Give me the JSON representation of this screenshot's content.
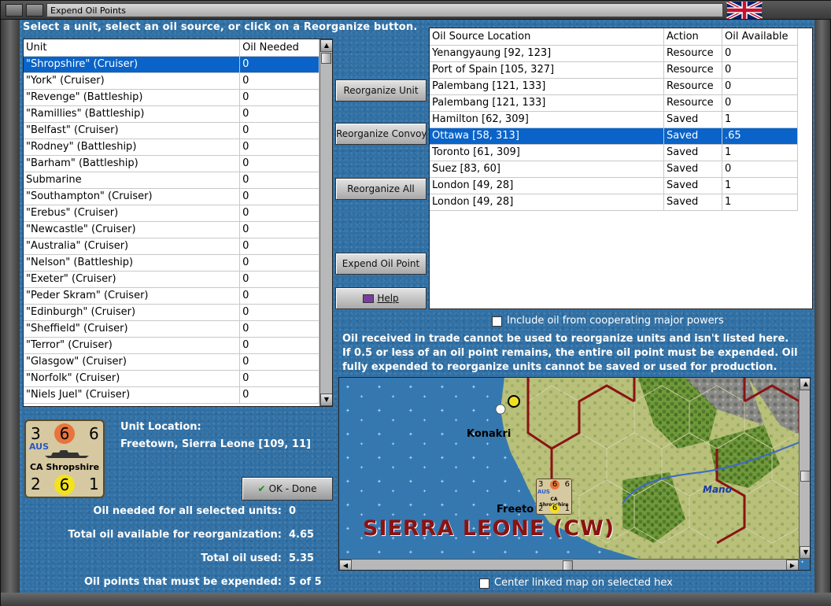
{
  "window": {
    "title": "Expend Oil Points"
  },
  "instruction": "Select a unit, select an oil source, or click on a Reorganize button.",
  "units_table": {
    "headers": [
      "Unit",
      "Oil Needed"
    ],
    "rows": [
      {
        "unit": "\"Shropshire\" (Cruiser)",
        "oil": "0",
        "selected": true
      },
      {
        "unit": "\"York\" (Cruiser)",
        "oil": "0"
      },
      {
        "unit": "\"Revenge\" (Battleship)",
        "oil": "0"
      },
      {
        "unit": "\"Ramillies\" (Battleship)",
        "oil": "0"
      },
      {
        "unit": "\"Belfast\" (Cruiser)",
        "oil": "0"
      },
      {
        "unit": "\"Rodney\" (Battleship)",
        "oil": "0"
      },
      {
        "unit": "\"Barham\" (Battleship)",
        "oil": "0"
      },
      {
        "unit": "Submarine",
        "oil": "0"
      },
      {
        "unit": "\"Southampton\" (Cruiser)",
        "oil": "0"
      },
      {
        "unit": "\"Erebus\" (Cruiser)",
        "oil": "0"
      },
      {
        "unit": "\"Newcastle\" (Cruiser)",
        "oil": "0"
      },
      {
        "unit": "\"Australia\" (Cruiser)",
        "oil": "0"
      },
      {
        "unit": "\"Nelson\" (Battleship)",
        "oil": "0"
      },
      {
        "unit": "\"Exeter\" (Cruiser)",
        "oil": "0"
      },
      {
        "unit": "\"Peder Skram\" (Cruiser)",
        "oil": "0"
      },
      {
        "unit": "\"Edinburgh\" (Cruiser)",
        "oil": "0"
      },
      {
        "unit": "\"Sheffield\" (Cruiser)",
        "oil": "0"
      },
      {
        "unit": "\"Terror\" (Cruiser)",
        "oil": "0"
      },
      {
        "unit": "\"Glasgow\" (Cruiser)",
        "oil": "0"
      },
      {
        "unit": "\"Norfolk\" (Cruiser)",
        "oil": "0"
      },
      {
        "unit": "\"Niels Juel\" (Cruiser)",
        "oil": "0"
      }
    ]
  },
  "sources_table": {
    "headers": [
      "Oil Source Location",
      "Action",
      "Oil Available"
    ],
    "rows": [
      {
        "location": "Yenangyaung [92, 123]",
        "action": "Resource",
        "available": "0"
      },
      {
        "location": "Port of Spain [105, 327]",
        "action": "Resource",
        "available": "0"
      },
      {
        "location": "Palembang [121, 133]",
        "action": "Resource",
        "available": "0"
      },
      {
        "location": "Palembang [121, 133]",
        "action": "Resource",
        "available": "0"
      },
      {
        "location": "Hamilton [62, 309]",
        "action": "Saved",
        "available": "1"
      },
      {
        "location": "Ottawa [58, 313]",
        "action": "Saved",
        "available": ".65",
        "selected": true
      },
      {
        "location": "Toronto [61, 309]",
        "action": "Saved",
        "available": "1"
      },
      {
        "location": "Suez [83, 60]",
        "action": "Saved",
        "available": "0"
      },
      {
        "location": "London [49, 28]",
        "action": "Saved",
        "available": "1"
      },
      {
        "location": "London [49, 28]",
        "action": "Saved",
        "available": "1"
      }
    ]
  },
  "buttons": {
    "reorganize_unit": "Reorganize Unit",
    "reorganize_convoy": "Reorganize Convoy",
    "reorganize_all": "Reorganize All",
    "expend_oil_point": "Expend Oil Point",
    "help": "Help",
    "ok_done": "OK - Done"
  },
  "include_oil_label": "Include oil from cooperating major powers",
  "note": "Oil received in trade cannot be used to reorganize units and isn't listed here.  If 0.5 or less of an oil point remains, the entire oil point must be expended.   Oil fully expended to reorganize units cannot be saved or used for production.",
  "unit_location": {
    "label": "Unit Location:",
    "value": "Freetown, Sierra Leone [109, 11]"
  },
  "counter": {
    "top_left": "3",
    "top_mid": "6",
    "top_right": "6",
    "nation": "AUS",
    "name": "CA Shropshire",
    "bottom_left": "2",
    "bottom_mid": "6",
    "bottom_right": "1",
    "mid_color": "#e8743c",
    "bottom_color": "#f4e21c"
  },
  "stats": {
    "oil_needed_label": "Oil needed for all selected units:",
    "oil_needed_value": "0",
    "total_available_label": "Total oil available for reorganization:",
    "total_available_value": "4.65",
    "total_used_label": "Total oil used:",
    "total_used_value": "5.35",
    "must_expend_label": "Oil points that must be expended:",
    "must_expend_value": "5 of 5"
  },
  "map": {
    "country_label": "SIERRA LEONE (CW)",
    "city1": "Konakri",
    "city2": "Freeto",
    "river": "Mano",
    "counter_small": {
      "tl": "3",
      "tm": "6",
      "tr": "6",
      "nation": "AUS",
      "name": "CA Shropshire",
      "bl": "2",
      "bm": "6",
      "br": "1"
    }
  },
  "center_map_label": "Center linked map on selected hex",
  "colors": {
    "selection": "#0a63c8",
    "panel_blue": "#2f6fa4",
    "border_red": "#8b1212"
  },
  "icons": {
    "ok": "check-icon",
    "help": "book-icon",
    "flag": "union-jack-icon"
  }
}
